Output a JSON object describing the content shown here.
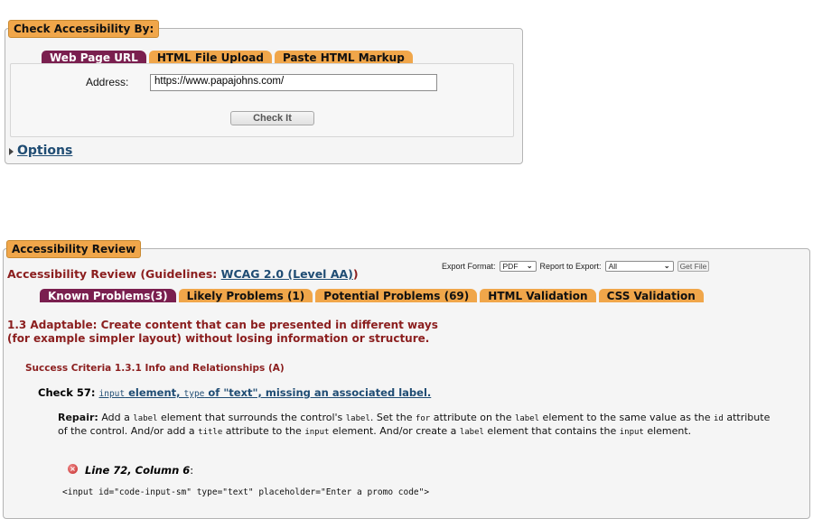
{
  "check_panel": {
    "legend": "Check Accessibility By:",
    "tabs": [
      {
        "label": "Web Page URL",
        "active": true
      },
      {
        "label": "HTML File Upload",
        "active": false
      },
      {
        "label": "Paste HTML Markup",
        "active": false
      }
    ],
    "address_label": "Address:",
    "address_value": "https://www.papajohns.com/",
    "check_button": "Check It",
    "options_link": "Options"
  },
  "review_panel": {
    "legend": "Accessibility Review",
    "title_prefix": "Accessibility Review (Guidelines: ",
    "guideline_link": "WCAG 2.0 (Level AA)",
    "title_suffix": ")",
    "export": {
      "format_label": "Export Format:",
      "format_value": "PDF",
      "report_label": "Report to Export:",
      "report_value": "All",
      "get_file_button": "Get File"
    },
    "tabs": [
      {
        "label": "Known Problems(3)",
        "active": true
      },
      {
        "label": "Likely Problems (1)",
        "active": false
      },
      {
        "label": "Potential Problems (69)",
        "active": false
      },
      {
        "label": "HTML Validation",
        "active": false
      },
      {
        "label": "CSS Validation",
        "active": false
      }
    ],
    "guideline_heading": "1.3 Adaptable: Create content that can be presented in different ways (for example simpler layout) without losing information or structure.",
    "success_criteria": "Success Criteria 1.3.1 Info and Relationships (A)",
    "check": {
      "label": "Check 57:",
      "link_parts": [
        "input",
        " element, ",
        "type",
        " of \"text\", missing an associated label."
      ]
    },
    "repair": {
      "label": "Repair:",
      "parts": [
        " Add a ",
        "label",
        " element that surrounds the control's ",
        "label",
        ". Set the ",
        "for",
        " attribute on the ",
        "label",
        " element to the same value as the ",
        "id",
        " attribute of the control. And/or add a ",
        "title",
        " attribute to the ",
        "input",
        " element. And/or create a ",
        "label",
        " element that contains the ",
        "input",
        " element."
      ]
    },
    "error": {
      "icon": "error-x-icon",
      "location": "Line 72, Column 6",
      "code": "<input id=\"code-input-sm\" type=\"text\" placeholder=\"Enter a promo code\">"
    }
  }
}
